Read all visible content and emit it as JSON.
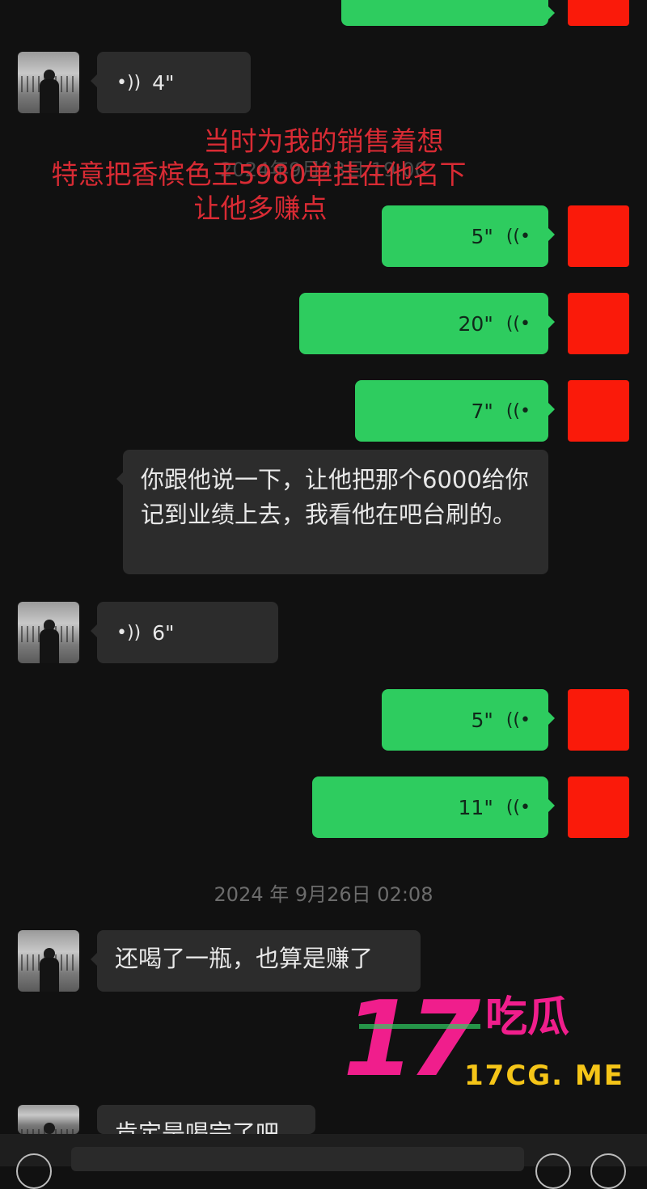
{
  "colors": {
    "background": "#111111",
    "outgoing_bubble": "#2ecc5f",
    "incoming_bubble": "#2c2c2c",
    "red_avatar": "#fa1a0a",
    "caption_red": "#d92b34",
    "watermark_pink": "#f01e8c",
    "watermark_yellow": "#f5c518"
  },
  "icons": {
    "voice_wave": "voice-wave-icon"
  },
  "overlay_caption": {
    "line1": "当时为我的销售着想",
    "line2": "特意把香槟色王5980单挂在他名下",
    "line3": "让他多赚点"
  },
  "messages": {
    "m1": {
      "duration": "4\""
    },
    "m2": {
      "duration": "5\""
    },
    "m3": {
      "duration": "20\""
    },
    "m4": {
      "duration": "7\""
    },
    "m5": {
      "text": "你跟他说一下，让他把那个6000给你记到业绩上去，我看他在吧台刷的。"
    },
    "m6": {
      "duration": "6\""
    },
    "m7": {
      "duration": "5\""
    },
    "m8": {
      "duration": "11\""
    },
    "m9": {
      "text": "还喝了一瓶，也算是赚了"
    },
    "m10": {
      "text": "肯定是喝完了吧 了了吖"
    }
  },
  "timestamps": {
    "ts1": "2024 年 9月26日 02:08",
    "ts_faded": "2024年9月23日 19:00"
  },
  "watermark": {
    "digits": "17",
    "chinese": "吃瓜",
    "url": "17CG. ME"
  }
}
